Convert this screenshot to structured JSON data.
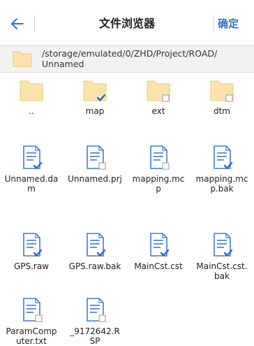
{
  "header": {
    "title": "文件浏览器",
    "ok_label": "确定"
  },
  "path": {
    "line1": "/storage/emulated/0/ZHD/Project/ROAD/",
    "line2": "Unnamed"
  },
  "colors": {
    "accent": "#2f6fce",
    "folder_fill": "#fbe3ae",
    "folder_edge": "#f0c76e",
    "file_edge": "#3d7dd6",
    "check": "#2a66c9"
  },
  "files": [
    {
      "name": "..",
      "type": "folder",
      "mark": "none"
    },
    {
      "name": "map",
      "type": "folder",
      "mark": "check"
    },
    {
      "name": "ext",
      "type": "folder",
      "mark": "box"
    },
    {
      "name": "dtm",
      "type": "folder",
      "mark": "box"
    },
    {
      "name": "Unnamed.dam",
      "type": "file",
      "mark": "check"
    },
    {
      "name": "Unnamed.prj",
      "type": "file",
      "mark": "box"
    },
    {
      "name": "mapping.mcp",
      "type": "file",
      "mark": "box"
    },
    {
      "name": "mapping.mcp.bak",
      "type": "file",
      "mark": "check"
    },
    {
      "name": "GPS.raw",
      "type": "file",
      "mark": "check"
    },
    {
      "name": "GPS.raw.bak",
      "type": "file",
      "mark": "check"
    },
    {
      "name": "MainCst.cst",
      "type": "file",
      "mark": "check"
    },
    {
      "name": "MainCst.cst.bak",
      "type": "file",
      "mark": "check"
    },
    {
      "name": "ParamComputer.txt",
      "type": "file",
      "mark": "box"
    },
    {
      "name": "_9172642.RSP",
      "type": "file",
      "mark": "box"
    }
  ]
}
